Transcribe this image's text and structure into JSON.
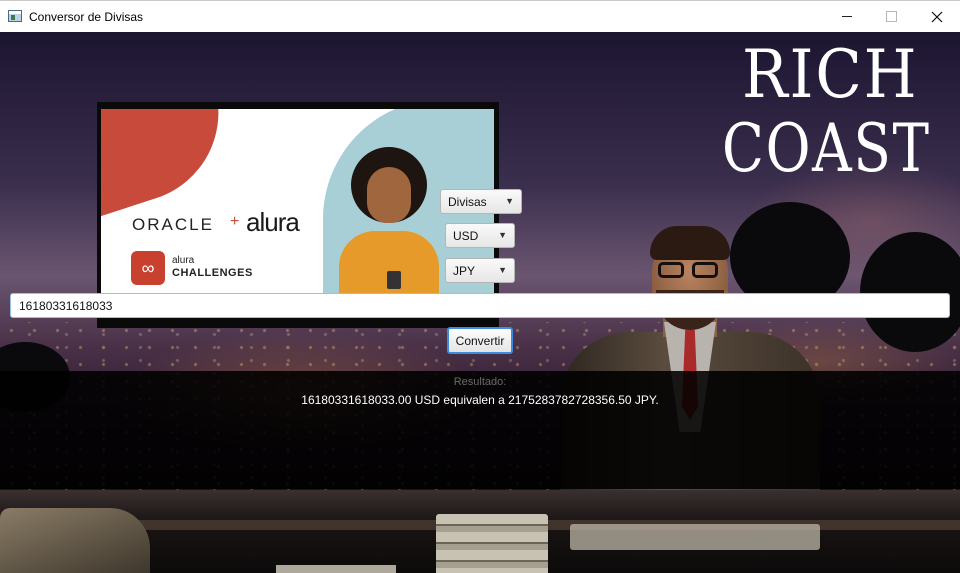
{
  "window": {
    "title": "Conversor de Divisas",
    "icon": "java-window-icon",
    "controls": [
      "minimize-icon",
      "maximize-icon",
      "close-icon"
    ]
  },
  "logo": {
    "line1": "RICH",
    "line2": "COAST"
  },
  "banner": {
    "brand_oracle": "ORACLE",
    "plus": "+",
    "brand_alura": "alura",
    "challenges_small": "alura",
    "challenges_big": "CHALLENGES"
  },
  "controls": {
    "type_select": {
      "value": "Divisas"
    },
    "from_select": {
      "value": "USD"
    },
    "to_select": {
      "value": "JPY"
    },
    "amount_input": {
      "value": "16180331618033"
    },
    "convert_button": "Convertir"
  },
  "result": {
    "label": "Resultado:",
    "text": "16180331618033.00 USD equivalen a 2175283782728356.50 JPY."
  },
  "colors": {
    "input_focus_border": "#9ac0e6",
    "button_focus_border": "#3d8be0",
    "result_background": "#000000"
  }
}
